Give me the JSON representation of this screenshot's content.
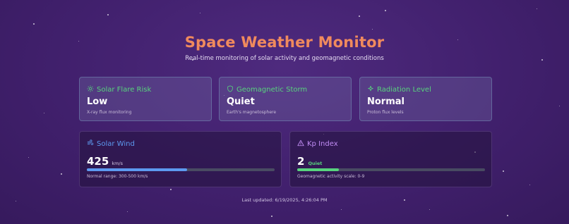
{
  "header": {
    "title": "Space Weather Monitor",
    "subtitle": "Real-time monitoring of solar activity and geomagnetic conditions"
  },
  "status_cards": [
    {
      "label": "Solar Flare Risk",
      "icon": "sun-icon",
      "value": "Low",
      "description": "X-ray flux monitoring",
      "accent": "#58d37e"
    },
    {
      "label": "Geomagnetic Storm",
      "icon": "shield-icon",
      "value": "Quiet",
      "description": "Earth's magnetosphere",
      "accent": "#58d37e"
    },
    {
      "label": "Radiation Level",
      "icon": "sparkle-icon",
      "value": "Normal",
      "description": "Proton flux levels",
      "accent": "#58d37e"
    }
  ],
  "solar_wind": {
    "label": "Solar Wind",
    "icon": "wind-icon",
    "value": "425",
    "unit": "km/s",
    "fill_fraction": 0.535,
    "note": "Normal range: 300-500 km/s",
    "accent": "#5d9af0"
  },
  "kp_index": {
    "label": "Kp Index",
    "icon": "warning-triangle-icon",
    "value": "2",
    "status": "Quiet",
    "fill_fraction": 0.22,
    "note": "Geomagnetic activity scale: 0-9",
    "accent": "#c18cf4",
    "bar_color": "#58d37e"
  },
  "footer": {
    "last_updated": "Last updated: 6/19/2025, 4:26:04 PM"
  }
}
